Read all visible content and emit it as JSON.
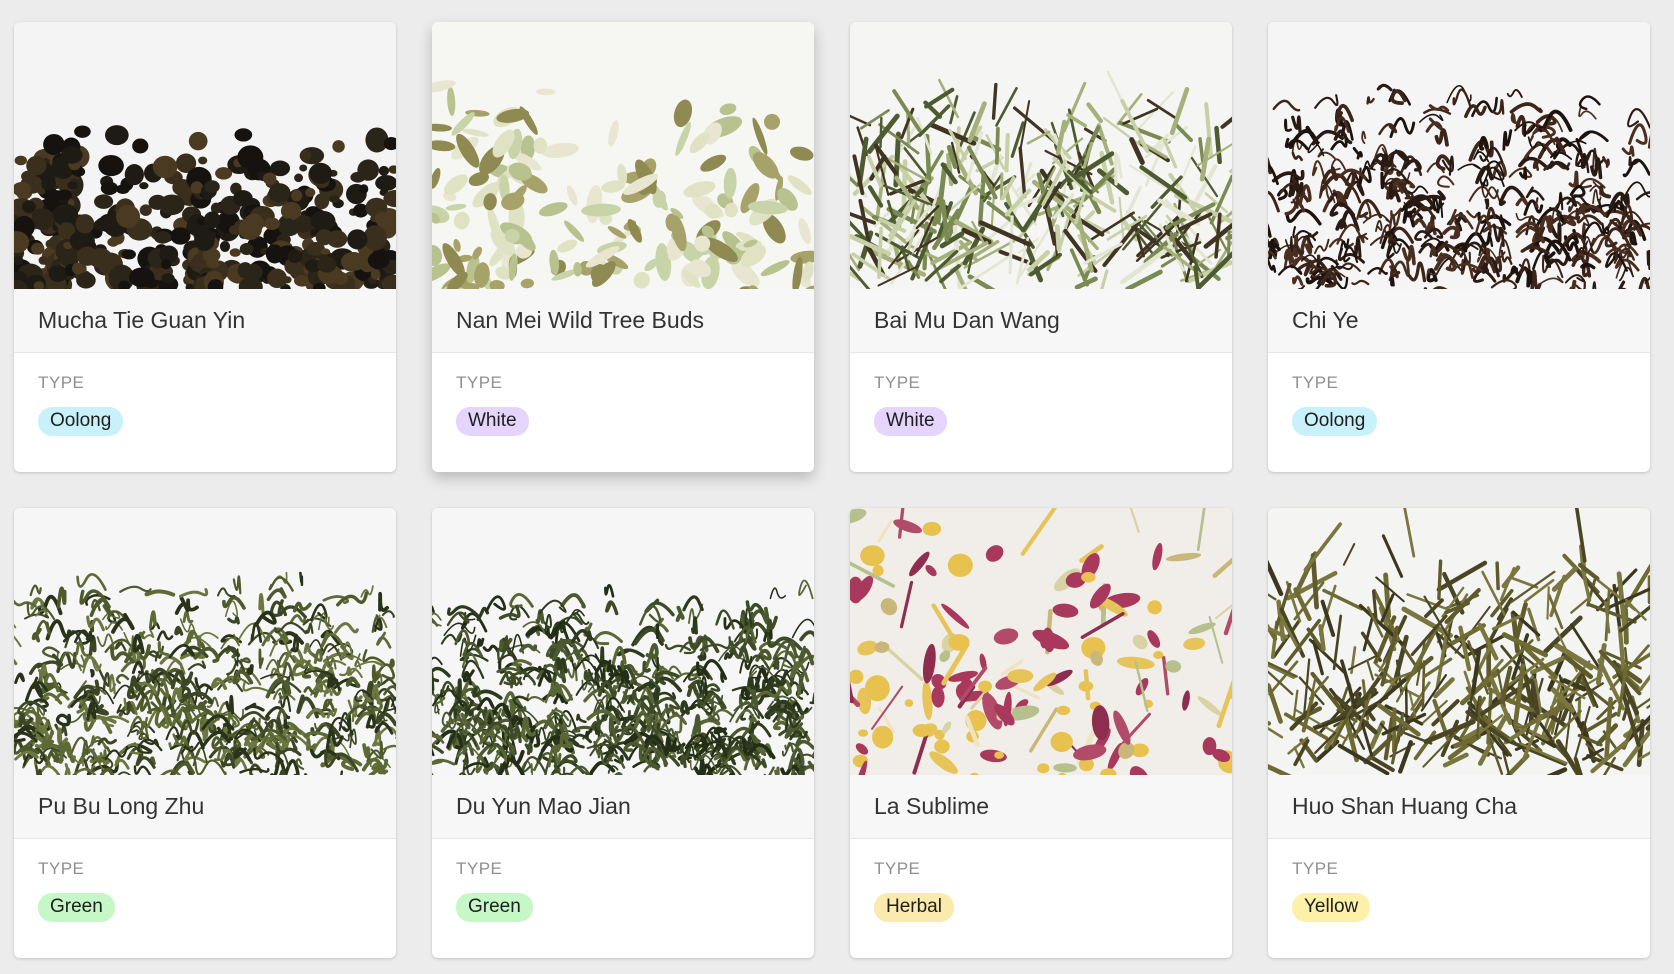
{
  "type_label": "TYPE",
  "badge_colors": {
    "Oolong": "#c8f1fb",
    "White": "#e5d4fb",
    "Green": "#c6f7c7",
    "Herbal": "#fbeaae",
    "Yellow": "#fdf0a9"
  },
  "teas": [
    {
      "name": "Mucha Tie Guan Yin",
      "type": "Oolong",
      "photo": "dark-rolled-oolong-leaves"
    },
    {
      "name": "Nan Mei Wild Tree Buds",
      "type": "White",
      "photo": "pale-white-tea-buds"
    },
    {
      "name": "Bai Mu Dan Wang",
      "type": "White",
      "photo": "silvery-green-white-tea-leaves"
    },
    {
      "name": "Chi Ye",
      "type": "Oolong",
      "photo": "dark-twisted-oolong-leaves"
    },
    {
      "name": "Pu Bu Long Zhu",
      "type": "Green",
      "photo": "curly-green-tea-leaves"
    },
    {
      "name": "Du Yun Mao Jian",
      "type": "Green",
      "photo": "wiry-green-tea-leaves"
    },
    {
      "name": "La Sublime",
      "type": "Herbal",
      "photo": "chamomile-rose-lemongrass-blend"
    },
    {
      "name": "Huo Shan Huang Cha",
      "type": "Yellow",
      "photo": "long-olive-yellow-tea-leaves"
    }
  ]
}
